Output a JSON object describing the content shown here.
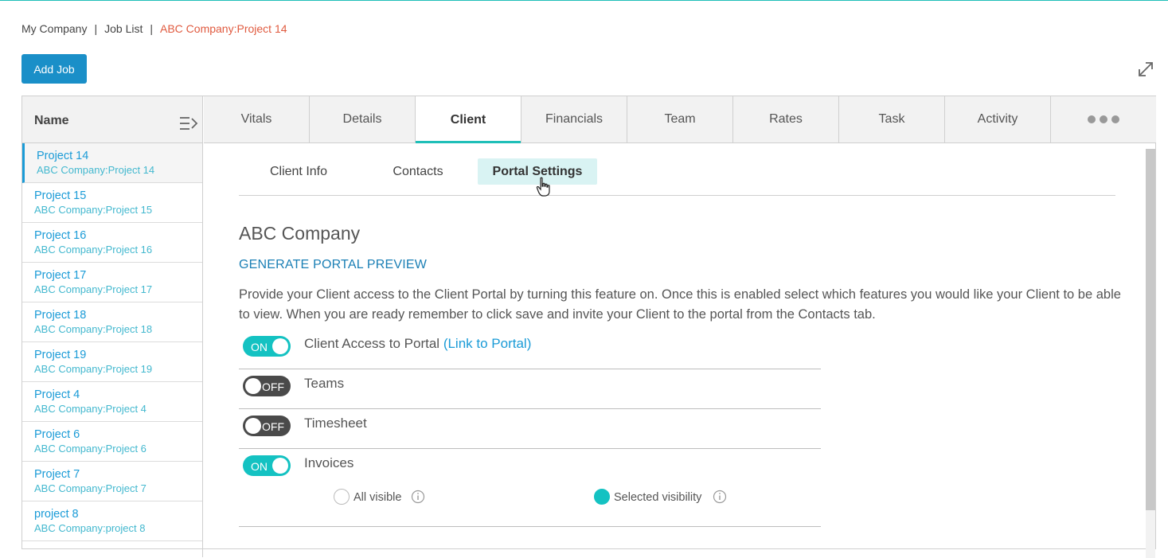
{
  "breadcrumb": {
    "items": [
      "My Company",
      "Job List"
    ],
    "current": "ABC Company:Project 14"
  },
  "toolbar": {
    "add_job_label": "Add Job"
  },
  "job_list": {
    "header": "Name",
    "items": [
      {
        "name": "Project 14",
        "sub": "ABC Company:Project 14"
      },
      {
        "name": "Project 15",
        "sub": "ABC Company:Project 15"
      },
      {
        "name": "Project 16",
        "sub": "ABC Company:Project 16"
      },
      {
        "name": "Project 17",
        "sub": "ABC Company:Project 17"
      },
      {
        "name": "Project 18",
        "sub": "ABC Company:Project 18"
      },
      {
        "name": "Project 19",
        "sub": "ABC Company:Project 19"
      },
      {
        "name": "Project 4",
        "sub": "ABC Company:Project 4"
      },
      {
        "name": "Project 6",
        "sub": "ABC Company:Project 6"
      },
      {
        "name": "Project 7",
        "sub": "ABC Company:Project 7"
      },
      {
        "name": "project 8",
        "sub": "ABC Company:project 8"
      }
    ]
  },
  "tabs": [
    "Vitals",
    "Details",
    "Client",
    "Financials",
    "Team",
    "Rates",
    "Task",
    "Activity"
  ],
  "active_tab": "Client",
  "subtabs": [
    "Client Info",
    "Contacts",
    "Portal Settings"
  ],
  "active_subtab": "Portal Settings",
  "portal": {
    "company": "ABC Company",
    "preview_link": "GENERATE PORTAL PREVIEW",
    "description": "Provide your Client access to the Client Portal by turning this feature on. Once this is enabled select which features you would like your Client to be able to view. When you are ready remember to click save and invite your Client to the portal from the Contacts tab.",
    "settings": [
      {
        "label": "Client Access to Portal",
        "link": "(Link to Portal)",
        "state": "ON"
      },
      {
        "label": "Teams",
        "link": "",
        "state": "OFF"
      },
      {
        "label": "Timesheet",
        "link": "",
        "state": "OFF"
      },
      {
        "label": "Invoices",
        "link": "",
        "state": "ON"
      }
    ],
    "invoice_visibility": {
      "all_visible": "All visible",
      "selected_visibility": "Selected visibility",
      "selected": "selected_visibility"
    }
  },
  "colors": {
    "accent": "#1fbfb8",
    "primary_button": "#1a8fc8",
    "breadcrumb_current": "#e05a3f",
    "link": "#1a9bd7",
    "toggle_on": "#14c2c2",
    "toggle_off": "#4a4a4a"
  }
}
